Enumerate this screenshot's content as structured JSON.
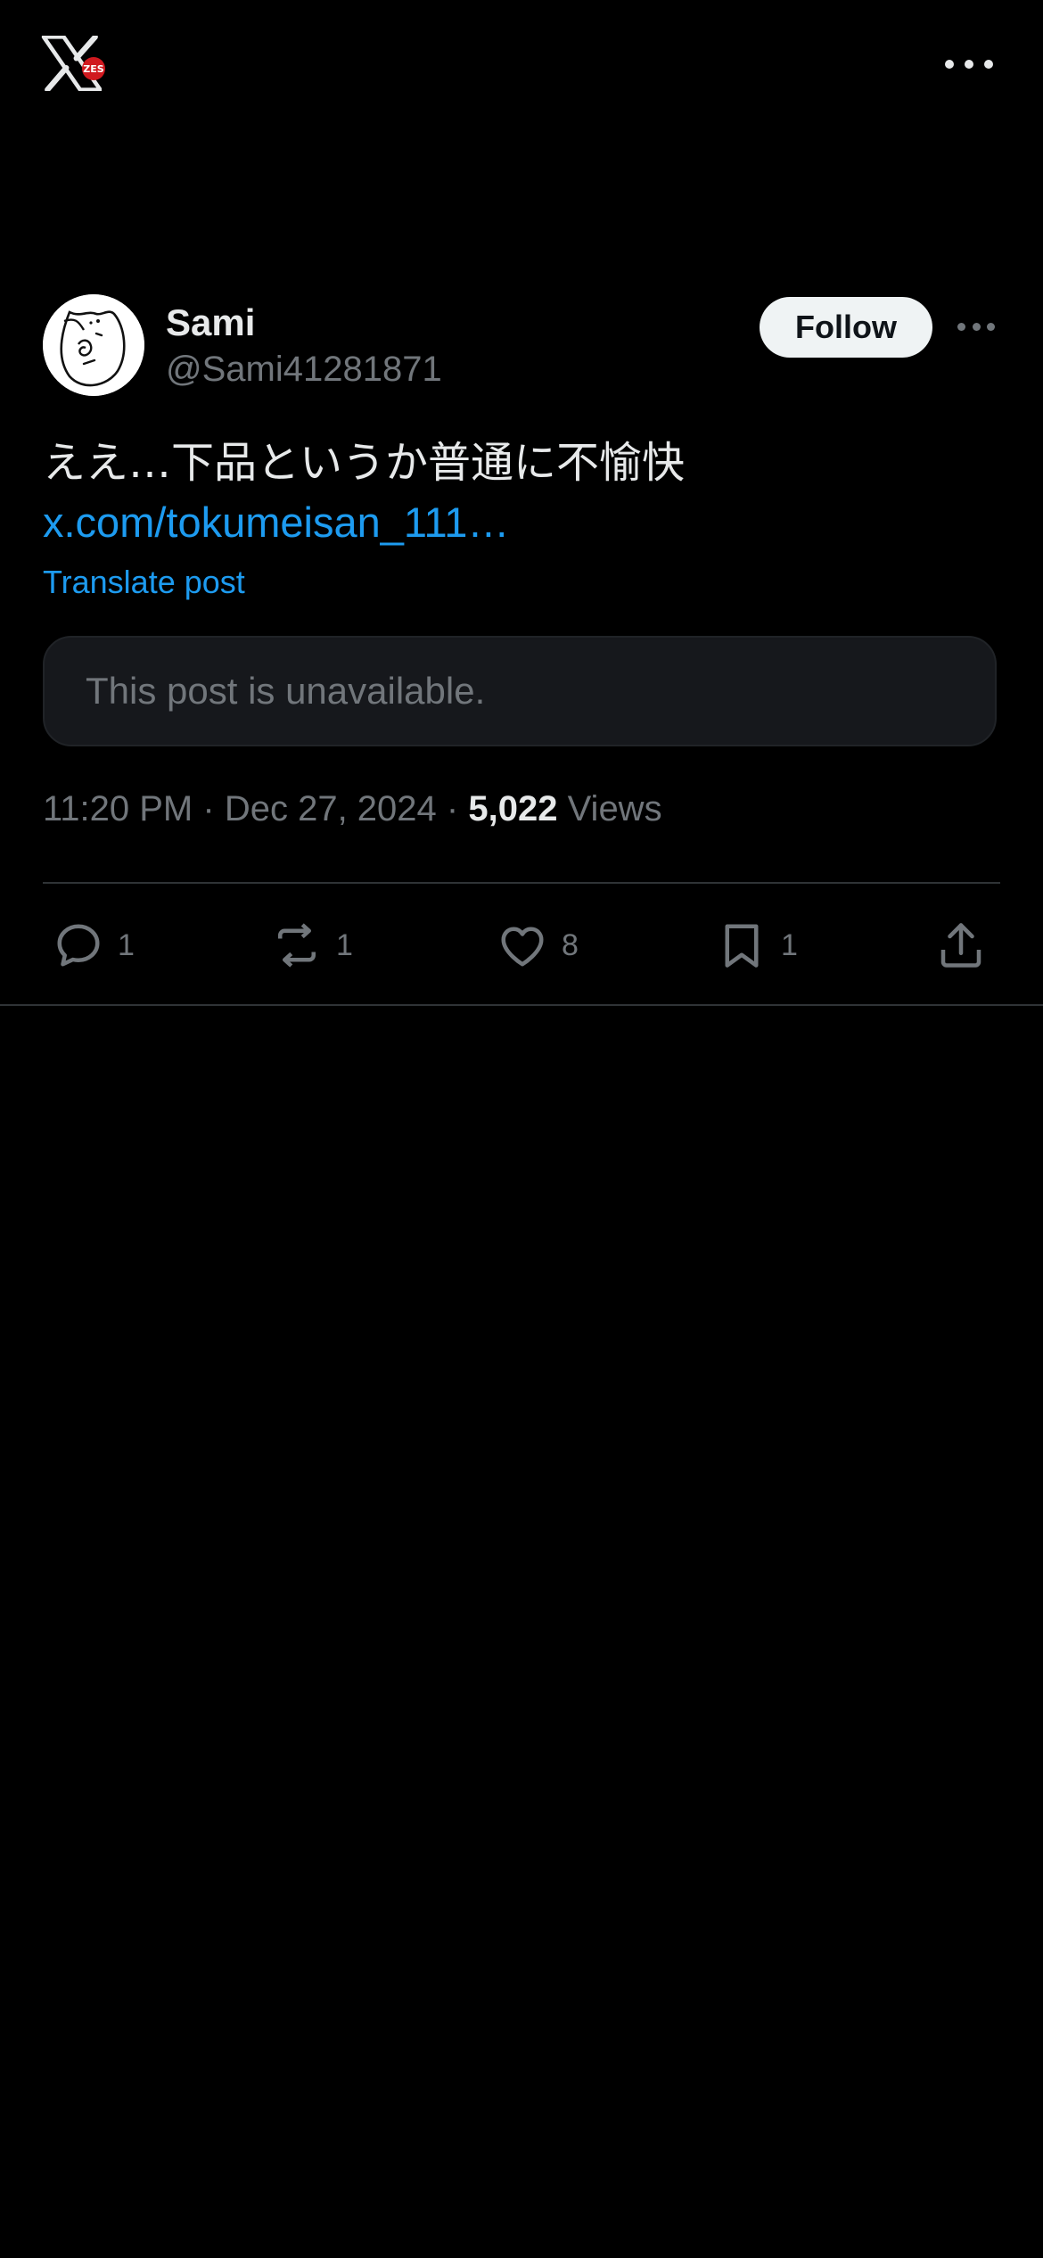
{
  "header": {
    "logo_badge": "ZES"
  },
  "post": {
    "author_name": "Sami",
    "author_handle": "@Sami41281871",
    "follow_label": "Follow",
    "text": "ええ…下品というか普通に不愉快",
    "link_text": "x.com/tokumeisan_111…",
    "translate_label": "Translate post",
    "quoted_unavailable": "This post is unavailable.",
    "time": "11:20 PM",
    "date": "Dec 27, 2024",
    "separator": "·",
    "views_count": "5,022",
    "views_label": "Views"
  },
  "actions": {
    "replies": "1",
    "reposts": "1",
    "likes": "8",
    "bookmarks": "1"
  },
  "colors": {
    "background": "#000000",
    "primary_text": "#e7e9ea",
    "secondary_text": "#71767b",
    "link": "#1d9bf0",
    "follow_button_bg": "#eff3f4"
  },
  "icons": [
    "x-logo-icon",
    "more-icon",
    "reply-icon",
    "repost-icon",
    "like-icon",
    "bookmark-icon",
    "share-icon"
  ]
}
